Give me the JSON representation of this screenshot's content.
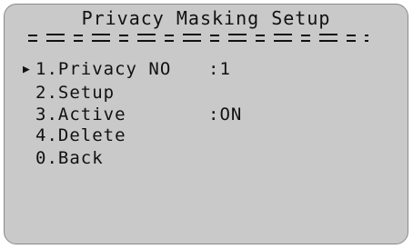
{
  "title": "Privacy Masking Setup",
  "cursor_symbol": "▶",
  "menu": {
    "items": [
      {
        "label": "1.Privacy NO",
        "value": ":1",
        "selected": true
      },
      {
        "label": "2.Setup",
        "value": "",
        "selected": false
      },
      {
        "label": "3.Active",
        "value": ":ON",
        "selected": false
      },
      {
        "label": "4.Delete",
        "value": "",
        "selected": false
      },
      {
        "label": "0.Back",
        "value": "",
        "selected": false
      }
    ]
  },
  "colors": {
    "background": "#c9c9c9",
    "text": "#111111",
    "border": "#8a8a8a"
  }
}
